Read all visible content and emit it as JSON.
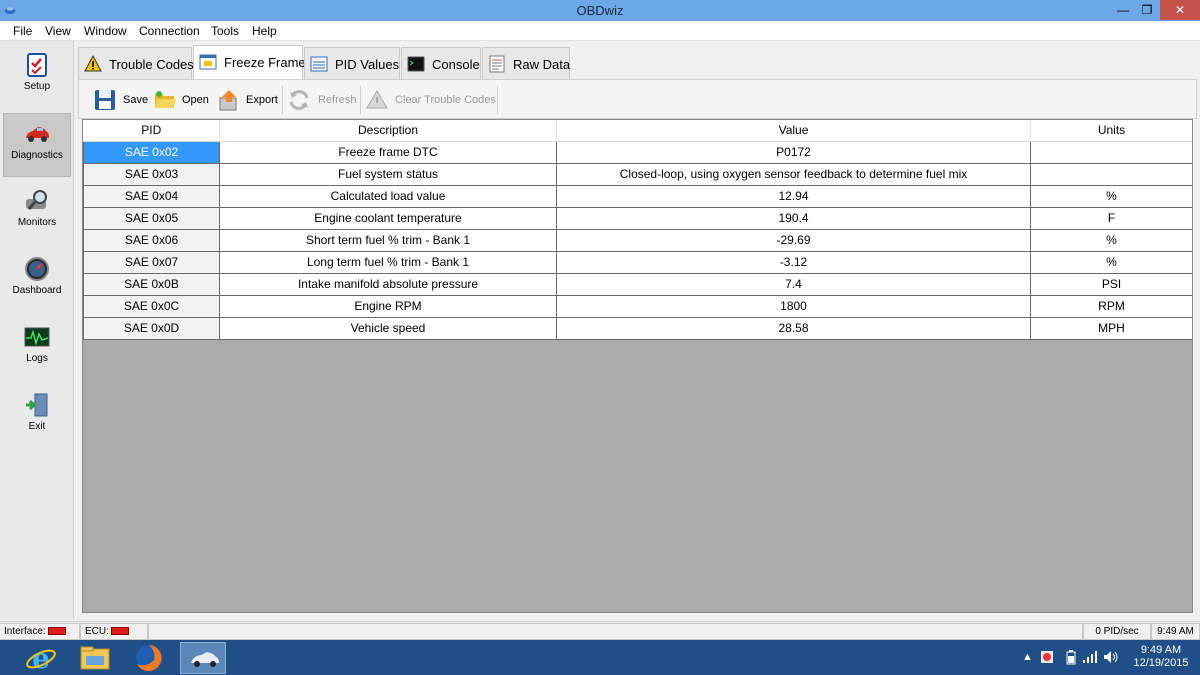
{
  "window": {
    "title": "OBDwiz"
  },
  "menu": [
    "File",
    "View",
    "Window",
    "Connection",
    "Tools",
    "Help"
  ],
  "nav": [
    {
      "label": "Setup",
      "icon": "checklist-icon"
    },
    {
      "label": "Diagnostics",
      "icon": "car-icon",
      "active": true
    },
    {
      "label": "Monitors",
      "icon": "magnifier-icon"
    },
    {
      "label": "Dashboard",
      "icon": "gauge-icon"
    },
    {
      "label": "Logs",
      "icon": "waveform-icon"
    },
    {
      "label": "Exit",
      "icon": "exit-door-icon"
    }
  ],
  "tabs": [
    {
      "label": "Trouble Codes",
      "icon": "warning-icon"
    },
    {
      "label": "Freeze Frame",
      "icon": "freeze-frame-icon",
      "active": true
    },
    {
      "label": "PID Values",
      "icon": "pid-values-icon"
    },
    {
      "label": "Console",
      "icon": "console-icon"
    },
    {
      "label": "Raw Data",
      "icon": "raw-data-icon"
    }
  ],
  "toolbar": {
    "save": "Save",
    "open": "Open",
    "export": "Export",
    "refresh": "Refresh",
    "clear": "Clear Trouble Codes"
  },
  "grid": {
    "headers": [
      "PID",
      "Description",
      "Value",
      "Units"
    ],
    "rows": [
      [
        "SAE 0x02",
        "Freeze frame DTC",
        "P0172",
        ""
      ],
      [
        "SAE 0x03",
        "Fuel system status",
        "Closed-loop, using oxygen sensor feedback to determine fuel mix",
        ""
      ],
      [
        "SAE 0x04",
        "Calculated load value",
        "12.94",
        "%"
      ],
      [
        "SAE 0x05",
        "Engine coolant temperature",
        "190.4",
        "F"
      ],
      [
        "SAE 0x06",
        "Short term fuel % trim - Bank 1",
        "-29.69",
        "%"
      ],
      [
        "SAE 0x07",
        "Long term fuel % trim - Bank 1",
        "-3.12",
        "%"
      ],
      [
        "SAE 0x0B",
        "Intake manifold absolute pressure",
        "7.4",
        "PSI"
      ],
      [
        "SAE 0x0C",
        "Engine RPM",
        "1800",
        "RPM"
      ],
      [
        "SAE 0x0D",
        "Vehicle speed",
        "28.58",
        "MPH"
      ]
    ]
  },
  "status": {
    "interface": "Interface:",
    "ecu": "ECU:",
    "rate": "0 PID/sec",
    "time": "9:49 AM",
    "indicator_color": "#e31b1b"
  },
  "taskbar": {
    "clock_time": "9:49 AM",
    "clock_date": "12/19/2015",
    "apps": [
      "ie-icon",
      "file-explorer-icon",
      "firefox-icon",
      "obdwiz-car-icon"
    ]
  }
}
